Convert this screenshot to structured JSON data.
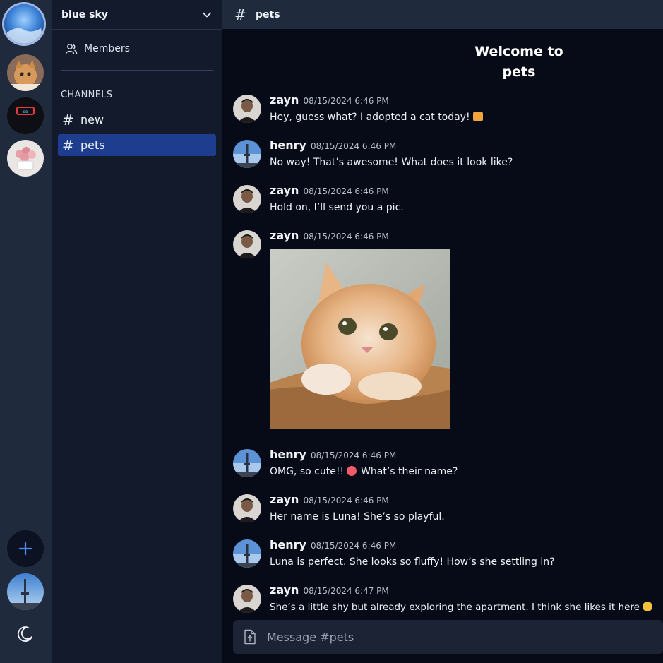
{
  "server": {
    "name": "blue sky"
  },
  "sidebar": {
    "members_label": "Members",
    "channels_title": "CHANNELS",
    "channels": [
      {
        "label": "new",
        "selected": false
      },
      {
        "label": "pets",
        "selected": true
      }
    ]
  },
  "channel": {
    "name": "pets",
    "welcome_line1": "Welcome to",
    "welcome_line2": "pets"
  },
  "messages": [
    {
      "user": "zayn",
      "time": "08/15/2024 6:46 PM",
      "text": "Hey, guess what? I adopted a cat today!",
      "emoji": "cat-face-icon"
    },
    {
      "user": "henry",
      "time": "08/15/2024 6:46 PM",
      "text": "No way! That’s awesome! What does it look like?"
    },
    {
      "user": "zayn",
      "time": "08/15/2024 6:46 PM",
      "text": "Hold on, I’ll send you a pic."
    },
    {
      "user": "zayn",
      "time": "08/15/2024 6:46 PM",
      "text": "",
      "attachment": "cat-photo"
    },
    {
      "user": "henry",
      "time": "08/15/2024 6:46 PM",
      "text_before": "OMG, so cute!!",
      "text": "What’s their name?",
      "emoji": "heart-eyes-icon"
    },
    {
      "user": "zayn",
      "time": "08/15/2024 6:46 PM",
      "text": "Her name is Luna! She’s so playful."
    },
    {
      "user": "henry",
      "time": "08/15/2024 6:46 PM",
      "text": "Luna is perfect. She looks so fluffy! How’s she settling in?"
    },
    {
      "user": "zayn",
      "time": "08/15/2024 6:47 PM",
      "text": "She’s a little shy but already exploring the apartment. I think she likes it here",
      "emoji": "smiling-face-icon"
    }
  ],
  "composer": {
    "placeholder": "Message #pets"
  },
  "colors": {
    "accent": "#1f3d8f",
    "add_icon": "#4c8df6",
    "background": "#070b18"
  }
}
